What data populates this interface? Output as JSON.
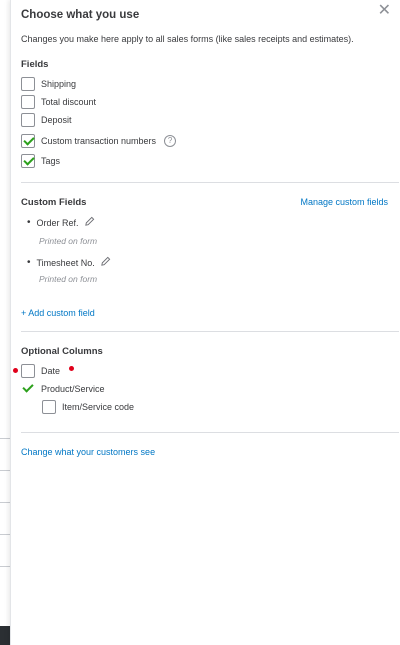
{
  "panel": {
    "title": "Choose what you use",
    "close_icon": "close-icon",
    "description": "Changes you make here apply to all sales forms (like sales receipts and estimates)."
  },
  "fields": {
    "title": "Fields",
    "items": [
      {
        "label": "Shipping",
        "checked": false
      },
      {
        "label": "Total discount",
        "checked": false
      },
      {
        "label": "Deposit",
        "checked": false
      },
      {
        "label": "Custom transaction numbers",
        "checked": true,
        "help": "?"
      },
      {
        "label": "Tags",
        "checked": true
      }
    ]
  },
  "custom_fields": {
    "title": "Custom Fields",
    "manage_link": "Manage custom fields",
    "items": [
      {
        "name": "Order Ref.",
        "note": "Printed on form"
      },
      {
        "name": "Timesheet No.",
        "note": "Printed on form"
      }
    ],
    "add_link": "+ Add custom field"
  },
  "optional_columns": {
    "title": "Optional Columns",
    "items": [
      {
        "label": "Date",
        "checked": false
      },
      {
        "label": "Product/Service",
        "checked": true
      },
      {
        "label": "Item/Service code",
        "checked": false
      }
    ]
  },
  "footer": {
    "change_link": "Change what your customers see"
  },
  "colors": {
    "accent_link": "#0077c5",
    "check_green": "#2ca01c",
    "marker_red": "#e0001b"
  }
}
